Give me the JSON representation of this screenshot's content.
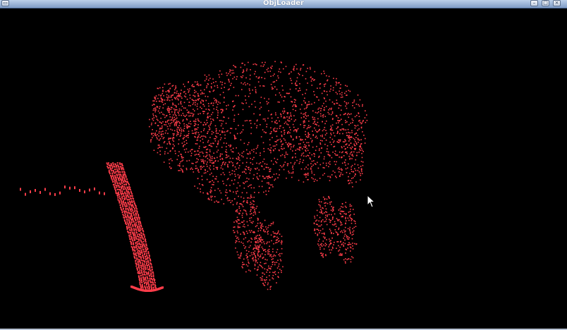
{
  "window": {
    "title": "ObjLoader",
    "buttons": [
      "window-menu",
      "minimize",
      "maximize",
      "close"
    ]
  },
  "viewport": {
    "background": "#000000",
    "model": "elephant point cloud",
    "point_color": "#ff3d4a"
  },
  "colors": {
    "titlebar": "#9db4d8",
    "point": "#ff3d4a",
    "background": "#000000"
  }
}
